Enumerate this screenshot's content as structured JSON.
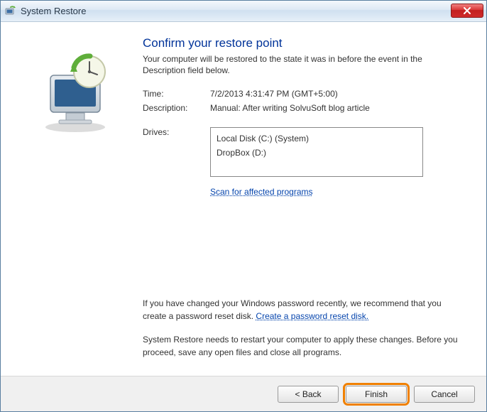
{
  "window": {
    "title": "System Restore"
  },
  "heading": "Confirm your restore point",
  "subtext": "Your computer will be restored to the state it was in before the event in the Description field below.",
  "fields": {
    "time_label": "Time:",
    "time_value": "7/2/2013 4:31:47 PM (GMT+5:00)",
    "desc_label": "Description:",
    "desc_value": "Manual: After writing SolvuSoft blog article",
    "drives_label": "Drives:",
    "drives": [
      "Local Disk (C:) (System)",
      "DropBox (D:)"
    ]
  },
  "links": {
    "scan": "Scan for affected programs",
    "create_disk": "Create a password reset disk."
  },
  "notices": {
    "pw_prefix": "If you have changed your Windows password recently, we recommend that you create a password reset disk. ",
    "restart": "System Restore needs to restart your computer to apply these changes. Before you proceed, save any open files and close all programs."
  },
  "buttons": {
    "back": "< Back",
    "finish": "Finish",
    "cancel": "Cancel"
  }
}
